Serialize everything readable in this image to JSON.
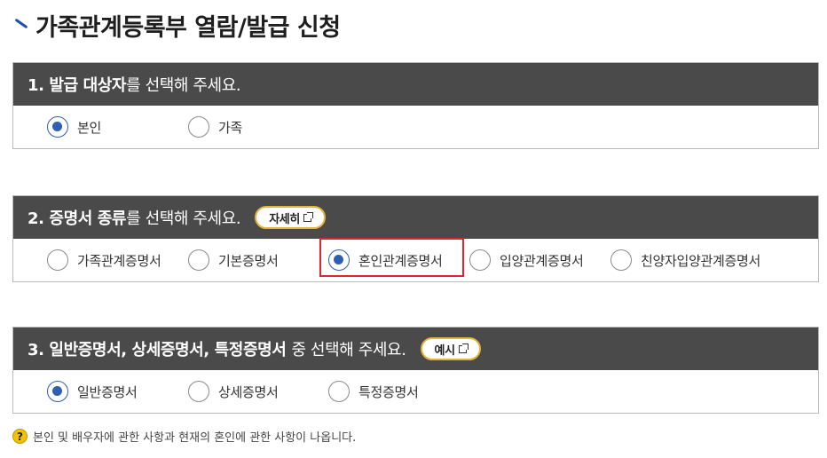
{
  "page_title": "가족관계등록부 열람/발급 신청",
  "sections": [
    {
      "heading_bold": "1. 발급 대상자",
      "heading_rest": "를 선택해 주세요.",
      "options": [
        {
          "label": "본인",
          "checked": true
        },
        {
          "label": "가족",
          "checked": false
        }
      ]
    },
    {
      "heading_bold": "2. 증명서 종류",
      "heading_rest": "를 선택해 주세요.",
      "button_label": "자세히",
      "options": [
        {
          "label": "가족관계증명서",
          "checked": false
        },
        {
          "label": "기본증명서",
          "checked": false
        },
        {
          "label": "혼인관계증명서",
          "checked": true
        },
        {
          "label": "입양관계증명서",
          "checked": false
        },
        {
          "label": "친양자입양관계증명서",
          "checked": false
        }
      ]
    },
    {
      "heading_bold": "3. 일반증명서, 상세증명서, 특정증명서",
      "heading_rest": "중 선택해 주세요.",
      "button_label": "예시",
      "options": [
        {
          "label": "일반증명서",
          "checked": true
        },
        {
          "label": "상세증명서",
          "checked": false
        },
        {
          "label": "특정증명서",
          "checked": false
        }
      ]
    }
  ],
  "note": {
    "icon": "question-icon",
    "text": "본인 및 배우자에 관한 사항과 현재의 혼인에 관한 사항이 나옵니다."
  },
  "colors": {
    "header_bg": "#4a4a4a",
    "radio_selected": "#2f5fb0",
    "highlight_border": "#e0242b",
    "button_border": "#e3b43c",
    "title_accent": "#1d4fb3"
  }
}
